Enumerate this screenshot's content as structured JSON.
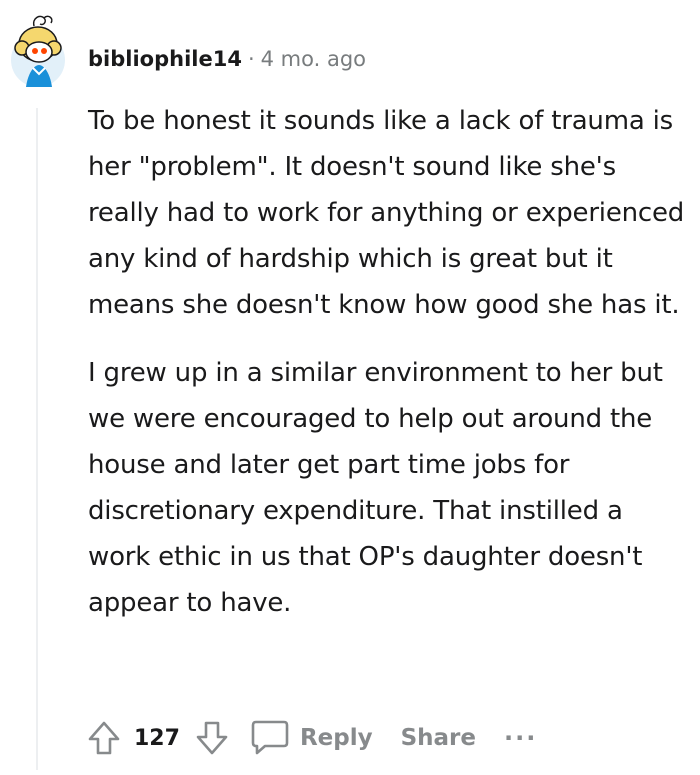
{
  "comment": {
    "username": "bibliophile14",
    "separator": "·",
    "age": "4 mo. ago",
    "paragraphs": [
      "To be honest it sounds like a lack of trauma is her \"problem\". It doesn't sound like she's really had to work for anything or experienced any kind of hardship which is great but it means she doesn't know how good she has it.",
      "I grew up in a similar environment to her but we were encouraged to help out around the house and later get part time jobs for discretionary expenditure. That instilled a work ethic in us that OP's daughter doesn't appear to have."
    ]
  },
  "actions": {
    "upvote_icon": "upvote-arrow-icon",
    "vote_count": "127",
    "downvote_icon": "downvote-arrow-icon",
    "reply_icon": "comment-bubble-icon",
    "reply_label": "Reply",
    "share_label": "Share",
    "more_label": "···"
  },
  "colors": {
    "text": "#1a1a1b",
    "meta": "#787c7e",
    "action": "#878a8c",
    "thread_line": "#edeff1",
    "avatar_bg": "#e2f0f9",
    "avatar_hair": "#f5d76e",
    "avatar_shirt": "#1a90d9"
  }
}
